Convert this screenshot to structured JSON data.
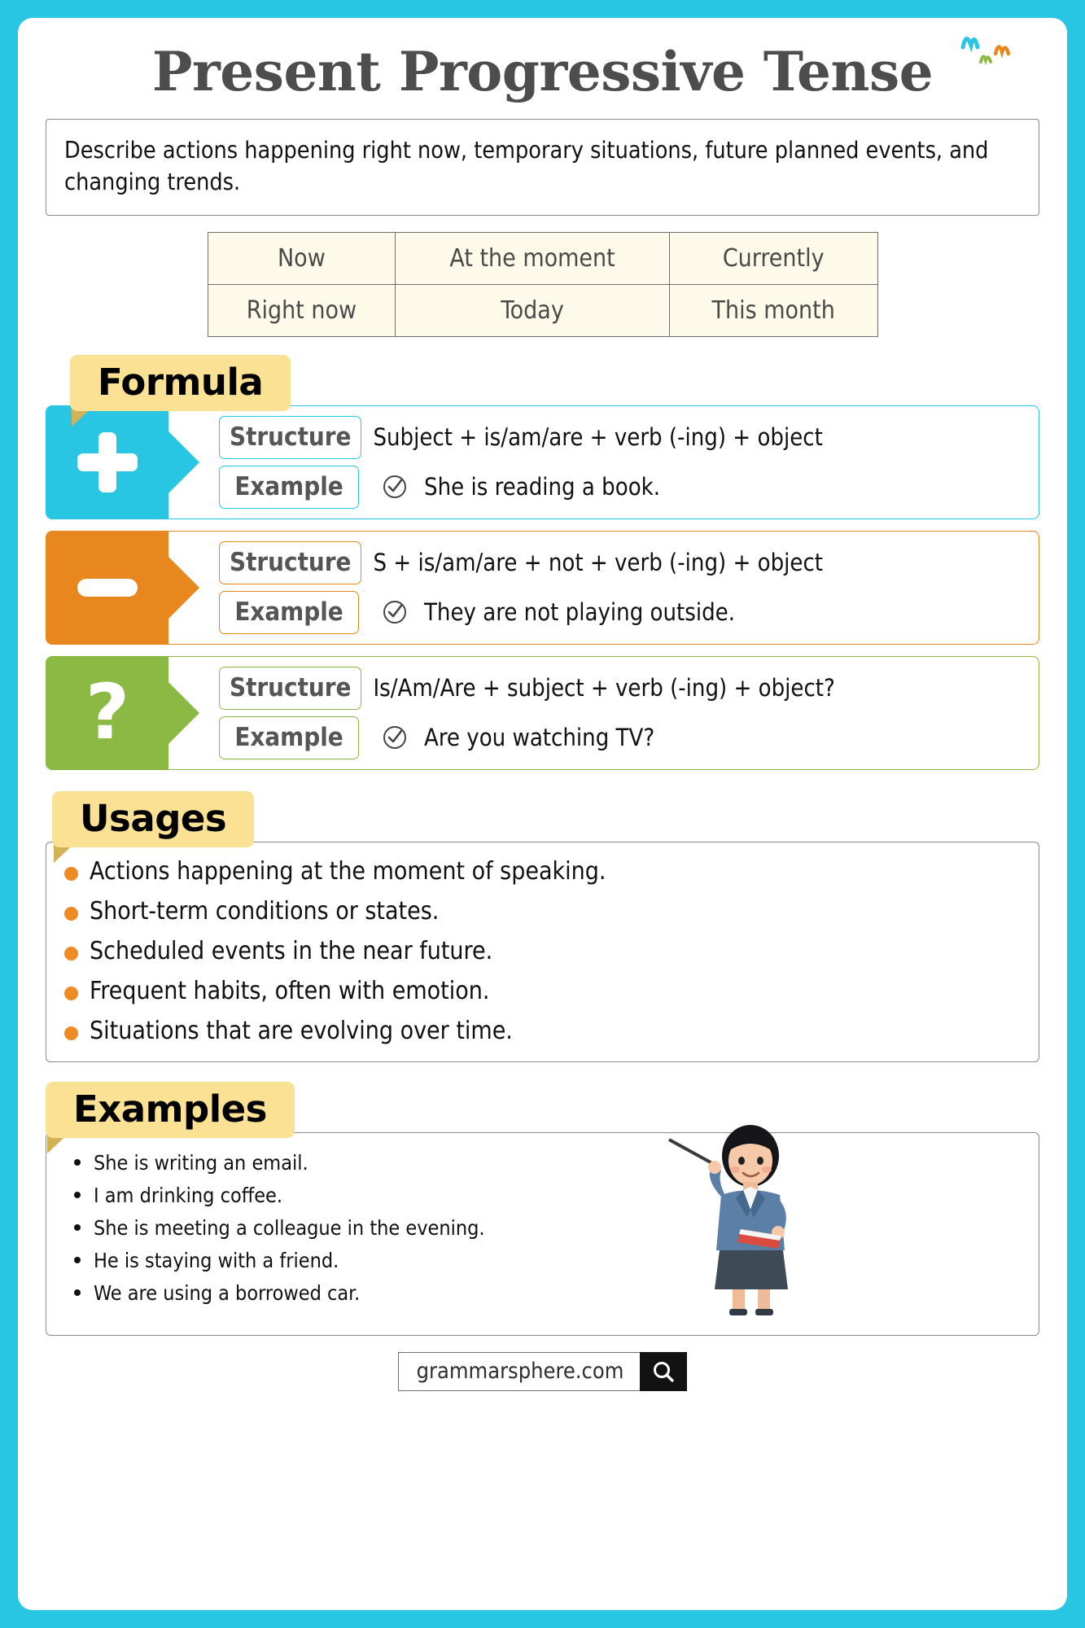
{
  "title": "Present Progressive Tense",
  "description": "Describe actions happening right now, temporary situations, future planned events, and changing trends.",
  "time_expressions": {
    "rows": [
      [
        "Now",
        "At the moment",
        "Currently"
      ],
      [
        "Right now",
        "Today",
        "This month"
      ]
    ]
  },
  "sections": {
    "formula_label": "Formula",
    "usages_label": "Usages",
    "examples_label": "Examples"
  },
  "labels": {
    "structure": "Structure",
    "example": "Example"
  },
  "formula": [
    {
      "sign": "plus-icon",
      "color": "#29c6e4",
      "structure": "Subject + is/am/are + verb (-ing) + object",
      "example": "She is reading a book."
    },
    {
      "sign": "minus-icon",
      "color": "#e8871e",
      "structure": "S + is/am/are + not + verb (-ing) + object",
      "example": "They are not playing outside."
    },
    {
      "sign": "question-icon",
      "color": "#8cb944",
      "structure": "Is/Am/Are + subject + verb (-ing) + object?",
      "example": "Are you watching TV?"
    }
  ],
  "usages": [
    "Actions happening at the moment of speaking.",
    "Short-term conditions or states.",
    "Scheduled events in the near future.",
    " Frequent habits, often with emotion.",
    "Situations that are evolving over time."
  ],
  "examples": [
    "She is writing an email.",
    "I am drinking coffee.",
    "She is meeting a colleague in the evening.",
    "He is staying with a friend.",
    "We are using a borrowed car."
  ],
  "footer": {
    "url": "grammarsphere.com",
    "search_icon": "search-icon"
  },
  "colors": {
    "page_border": "#29c6e4",
    "banner": "#fbe193",
    "affirmative": "#29c6e4",
    "negative": "#e8871e",
    "question": "#8cb944",
    "bullet": "#ef8b23",
    "title": "#4d4d4d"
  }
}
